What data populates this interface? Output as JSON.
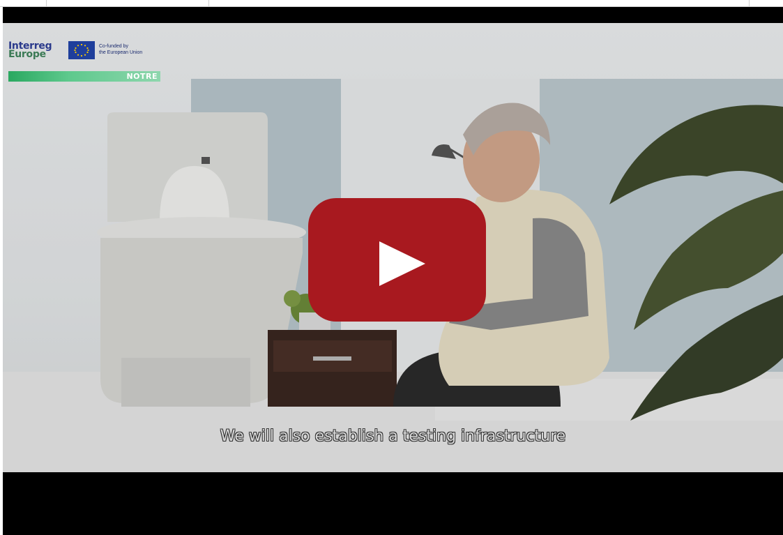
{
  "video": {
    "subtitle": "We will also establish a testing infrastructure"
  },
  "branding": {
    "wordmark_line1": "Interreg",
    "wordmark_line2": "Europe",
    "cofunded_line1": "Co-funded by",
    "cofunded_line2": "the European Union",
    "project_name": "NOTRE"
  },
  "colors": {
    "play_button": "#a8191f",
    "player_background": "#000000",
    "notre_bar": "#2aa860"
  },
  "icons": {
    "play": "youtube-play-icon",
    "flag": "eu-flag-icon"
  }
}
